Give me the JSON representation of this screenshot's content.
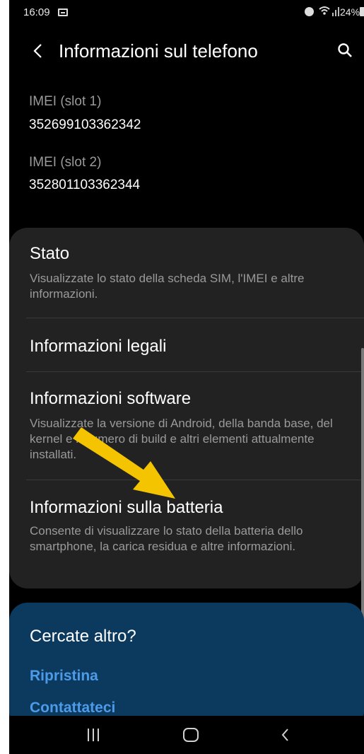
{
  "status_bar": {
    "time": "16:09",
    "battery": "24%",
    "icons": [
      "gallery-icon",
      "alarm-icon",
      "wifi-icon",
      "signal-icon",
      "battery-icon"
    ]
  },
  "header": {
    "title": "Informazioni sul telefono",
    "back_icon": "back-icon",
    "search_icon": "search-icon"
  },
  "imei": [
    {
      "label": "IMEI (slot 1)",
      "value": "352699103362342"
    },
    {
      "label": "IMEI (slot 2)",
      "value": "352801103362344"
    }
  ],
  "items": [
    {
      "title": "Stato",
      "desc": "Visualizzate lo stato della scheda SIM, l'IMEI e altre informazioni."
    },
    {
      "title": "Informazioni legali",
      "desc": ""
    },
    {
      "title": "Informazioni software",
      "desc": "Visualizzate la versione di Android, della banda base, del kernel e il numero di build e altri elementi attualmente installati."
    },
    {
      "title": "Informazioni sulla batteria",
      "desc": "Consente di visualizzare lo stato della batteria dello smartphone, la carica residua e altre informazioni."
    }
  ],
  "looking_for": {
    "title": "Cercate altro?",
    "links": [
      "Ripristina",
      "Contattateci"
    ]
  },
  "nav": {
    "icons": [
      "recent-apps-icon",
      "home-icon",
      "back-icon"
    ]
  },
  "colors": {
    "background": "#000000",
    "card": "#222222",
    "looking_card": "#0c3a5f",
    "link": "#4d9be8",
    "arrow": "#f5c400"
  }
}
